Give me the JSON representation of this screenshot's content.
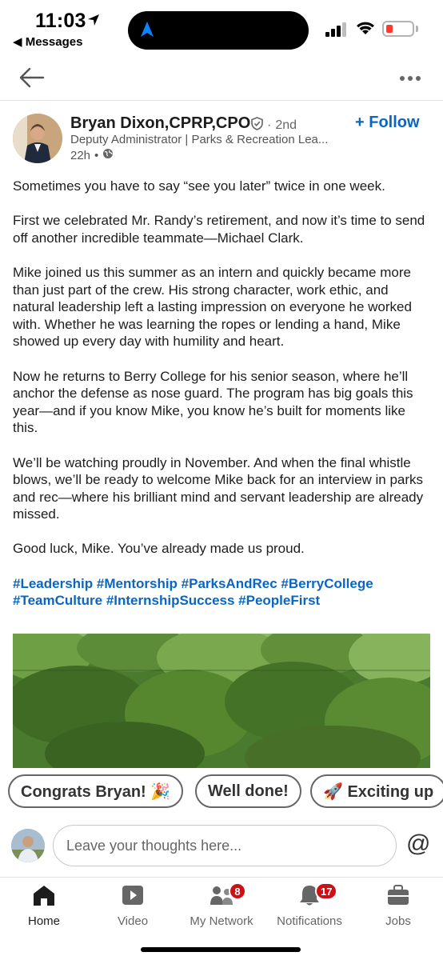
{
  "status": {
    "time": "11:03",
    "back_app": "◀ Messages"
  },
  "post": {
    "author": "Bryan Dixon,CPRP,CPO",
    "degree": "2nd",
    "headline": "Deputy Administrator | Parks & Recreation Lea...",
    "time": "22h",
    "follow_label": "+ Follow",
    "paragraphs": [
      "Sometimes you have to say “see you later” twice in one week.",
      "First we celebrated Mr. Randy’s retirement, and now it’s time to send off another incredible teammate—Michael Clark.",
      "Mike joined us this summer as an intern and quickly became more than just part of the crew. His strong character, work ethic, and natural leadership left a lasting impression on everyone he worked with. Whether he was learning the ropes or lending a hand, Mike showed up every day with humility and heart.",
      "Now he returns to Berry College for his senior season, where he’ll anchor the defense as nose guard. The program has big goals this year—and if you know Mike, you know he’s built for moments like this.",
      "We’ll be watching proudly in November. And when the final whistle blows, we’ll be ready to welcome Mike back for an interview in parks and rec—where his brilliant mind and servant leadership are already missed.",
      "Good luck, Mike. You’ve already made us proud."
    ],
    "hashtags": "#Leadership #Mentorship #ParksAndRec #BerryCollege #TeamCulture #InternshipSuccess #PeopleFirst"
  },
  "quick_replies": [
    "Congrats Bryan! 🎉",
    "Well done!",
    "🚀 Exciting up"
  ],
  "comment": {
    "placeholder": "Leave your thoughts here..."
  },
  "tabs": [
    {
      "label": "Home",
      "icon": "home-icon",
      "active": true
    },
    {
      "label": "Video",
      "icon": "video-icon"
    },
    {
      "label": "My Network",
      "icon": "network-icon",
      "badge": "8"
    },
    {
      "label": "Notifications",
      "icon": "bell-icon",
      "badge": "17"
    },
    {
      "label": "Jobs",
      "icon": "briefcase-icon"
    }
  ],
  "colors": {
    "accent": "#0a66c2",
    "badge": "#cc1016",
    "battery_low": "#ff3b30"
  }
}
